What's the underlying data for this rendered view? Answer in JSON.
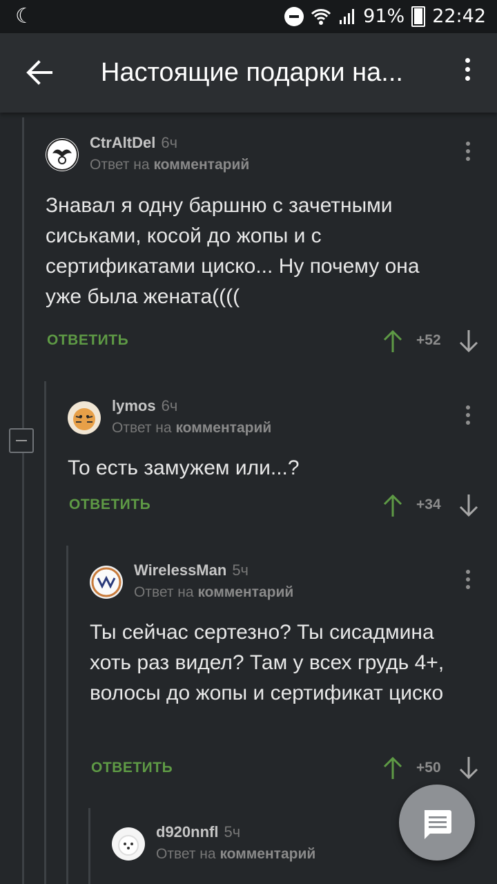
{
  "statusbar": {
    "battery": "91%",
    "time": "22:42"
  },
  "header": {
    "title": "Настоящие подарки на..."
  },
  "comments": [
    {
      "author": "CtrAltDel",
      "time": "6ч",
      "reply_prefix": "Ответ на",
      "reply_target": "комментарий",
      "text": "Знавал я одну баршню с зачетными сиськами, косой до жопы и с сертификатами циско... Ну почему она уже была жената((((",
      "reply_label": "ОТВЕТИТЬ",
      "score": "+52"
    },
    {
      "author": "lymos",
      "time": "6ч",
      "reply_prefix": "Ответ на",
      "reply_target": "комментарий",
      "text": "То есть замужем или...?",
      "reply_label": "ОТВЕТИТЬ",
      "score": "+34"
    },
    {
      "author": "WirelessMan",
      "time": "5ч",
      "reply_prefix": "Ответ на",
      "reply_target": "комментарий",
      "text": "Ты сейчас сертезно? Ты сисадмина хоть раз видел? Там у всех грудь 4+, волосы до жопы и сертификат циско",
      "reply_label": "ОТВЕТИТЬ",
      "score": "+50"
    },
    {
      "author": "d920nnfl",
      "time": "5ч",
      "reply_prefix": "Ответ на",
      "reply_target": "комментарий"
    }
  ],
  "colors": {
    "accent": "#5e9a45",
    "background": "#24272a",
    "appbar": "#2b2e31"
  }
}
